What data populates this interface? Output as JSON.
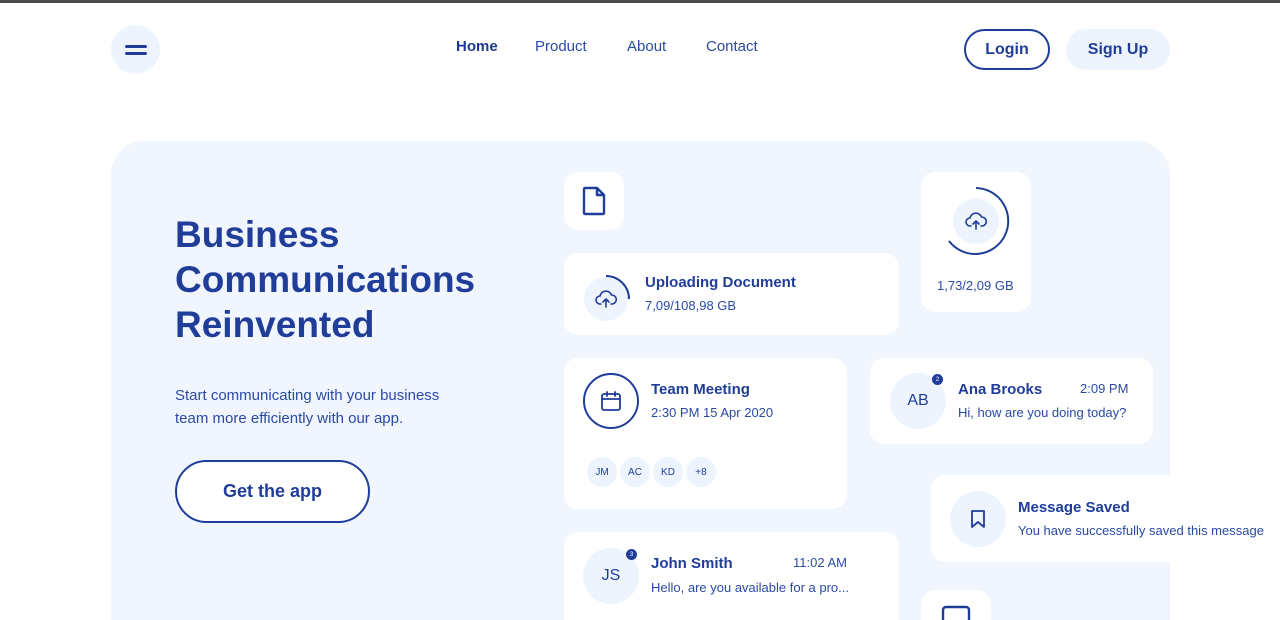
{
  "header": {
    "menu_icon": "menu-icon",
    "nav": [
      "Home",
      "Product",
      "About",
      "Contact"
    ],
    "active_nav": "Home",
    "login_label": "Login",
    "signup_label": "Sign Up"
  },
  "hero": {
    "title_lines": [
      "Business",
      "Communications",
      "Reinvented"
    ],
    "desc_lines": [
      "Start communicating with your business",
      "team more efficiently with our app."
    ],
    "cta_label": "Get the app"
  },
  "cards": {
    "file": {
      "icon": "file-icon"
    },
    "upload": {
      "title": "Uploading Document",
      "size": "7,09/108,98 GB",
      "icon": "cloud-upload-icon"
    },
    "storage": {
      "size": "1,73/2,09 GB",
      "icon": "cloud-upload-icon"
    },
    "meeting": {
      "title": "Team Meeting",
      "time": "2:30 PM 15 Apr 2020",
      "icon": "calendar-icon",
      "attendees": [
        "JM",
        "AC",
        "KD",
        "+8"
      ]
    },
    "ana": {
      "initials": "AB",
      "badge": "2",
      "name": "Ana Brooks",
      "time": "2:09 PM",
      "message": "Hi, how are you doing today?"
    },
    "saved": {
      "title": "Message Saved",
      "message": "You have successfully saved this message",
      "icon": "bookmark-icon"
    },
    "john": {
      "initials": "JS",
      "badge": "3",
      "name": "John Smith",
      "time": "11:02 AM",
      "message": "Hello, are you available for a pro..."
    },
    "bottom": {
      "icon": "message-icon"
    }
  },
  "colors": {
    "primary": "#1f3d99",
    "hero_bg": "#f0f5fe",
    "circle_bg": "#eef4fe"
  }
}
